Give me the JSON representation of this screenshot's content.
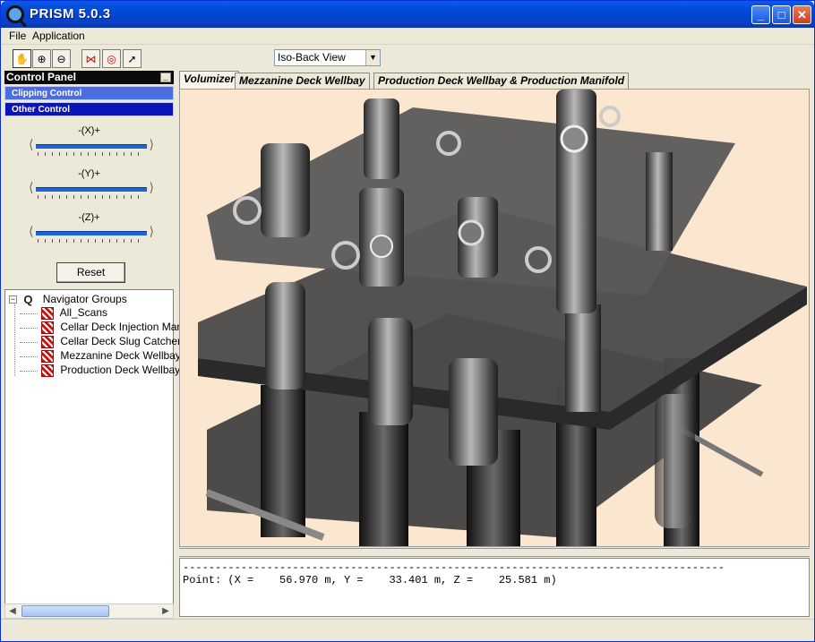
{
  "window": {
    "title": "PRISM 5.0.3"
  },
  "titlebar": {
    "min": "_",
    "max": "□",
    "close": "✕"
  },
  "menu": {
    "file": "File",
    "application": "Application"
  },
  "toolbar": {
    "view_select": "Iso-Back View",
    "tools": [
      "hand-icon",
      "zoom-in-icon",
      "zoom-out-icon",
      "bowtie-icon",
      "target-icon",
      "select-pointer-icon"
    ]
  },
  "control_panel": {
    "title": "Control Panel",
    "min": "_",
    "tabs": {
      "clipping": "Clipping Control",
      "other": "Other Control"
    },
    "axes": {
      "x": "-(X)+",
      "y": "-(Y)+",
      "z": "-(Z)+"
    },
    "reset": "Reset"
  },
  "navigator": {
    "root": "Navigator Groups",
    "expander": "−",
    "items": [
      "All_Scans",
      "Cellar Deck Injection Mani",
      "Cellar Deck Slug Catcher",
      "Mezzanine Deck Wellbay",
      "Production Deck Wellbay"
    ]
  },
  "tabs": [
    "Volumizer",
    "Mezzanine Deck Wellbay",
    "Production Deck Wellbay & Production Manifold"
  ],
  "console": {
    "rule": "------------------------------------------------------------------------------------",
    "point": "Point: (X =    56.970 m, Y =    33.401 m, Z =    25.581 m)"
  },
  "colors": {
    "viewport_bg": "#fbe6cf",
    "accent": "#0a14b8",
    "clip_tab": "#4a6de0"
  }
}
